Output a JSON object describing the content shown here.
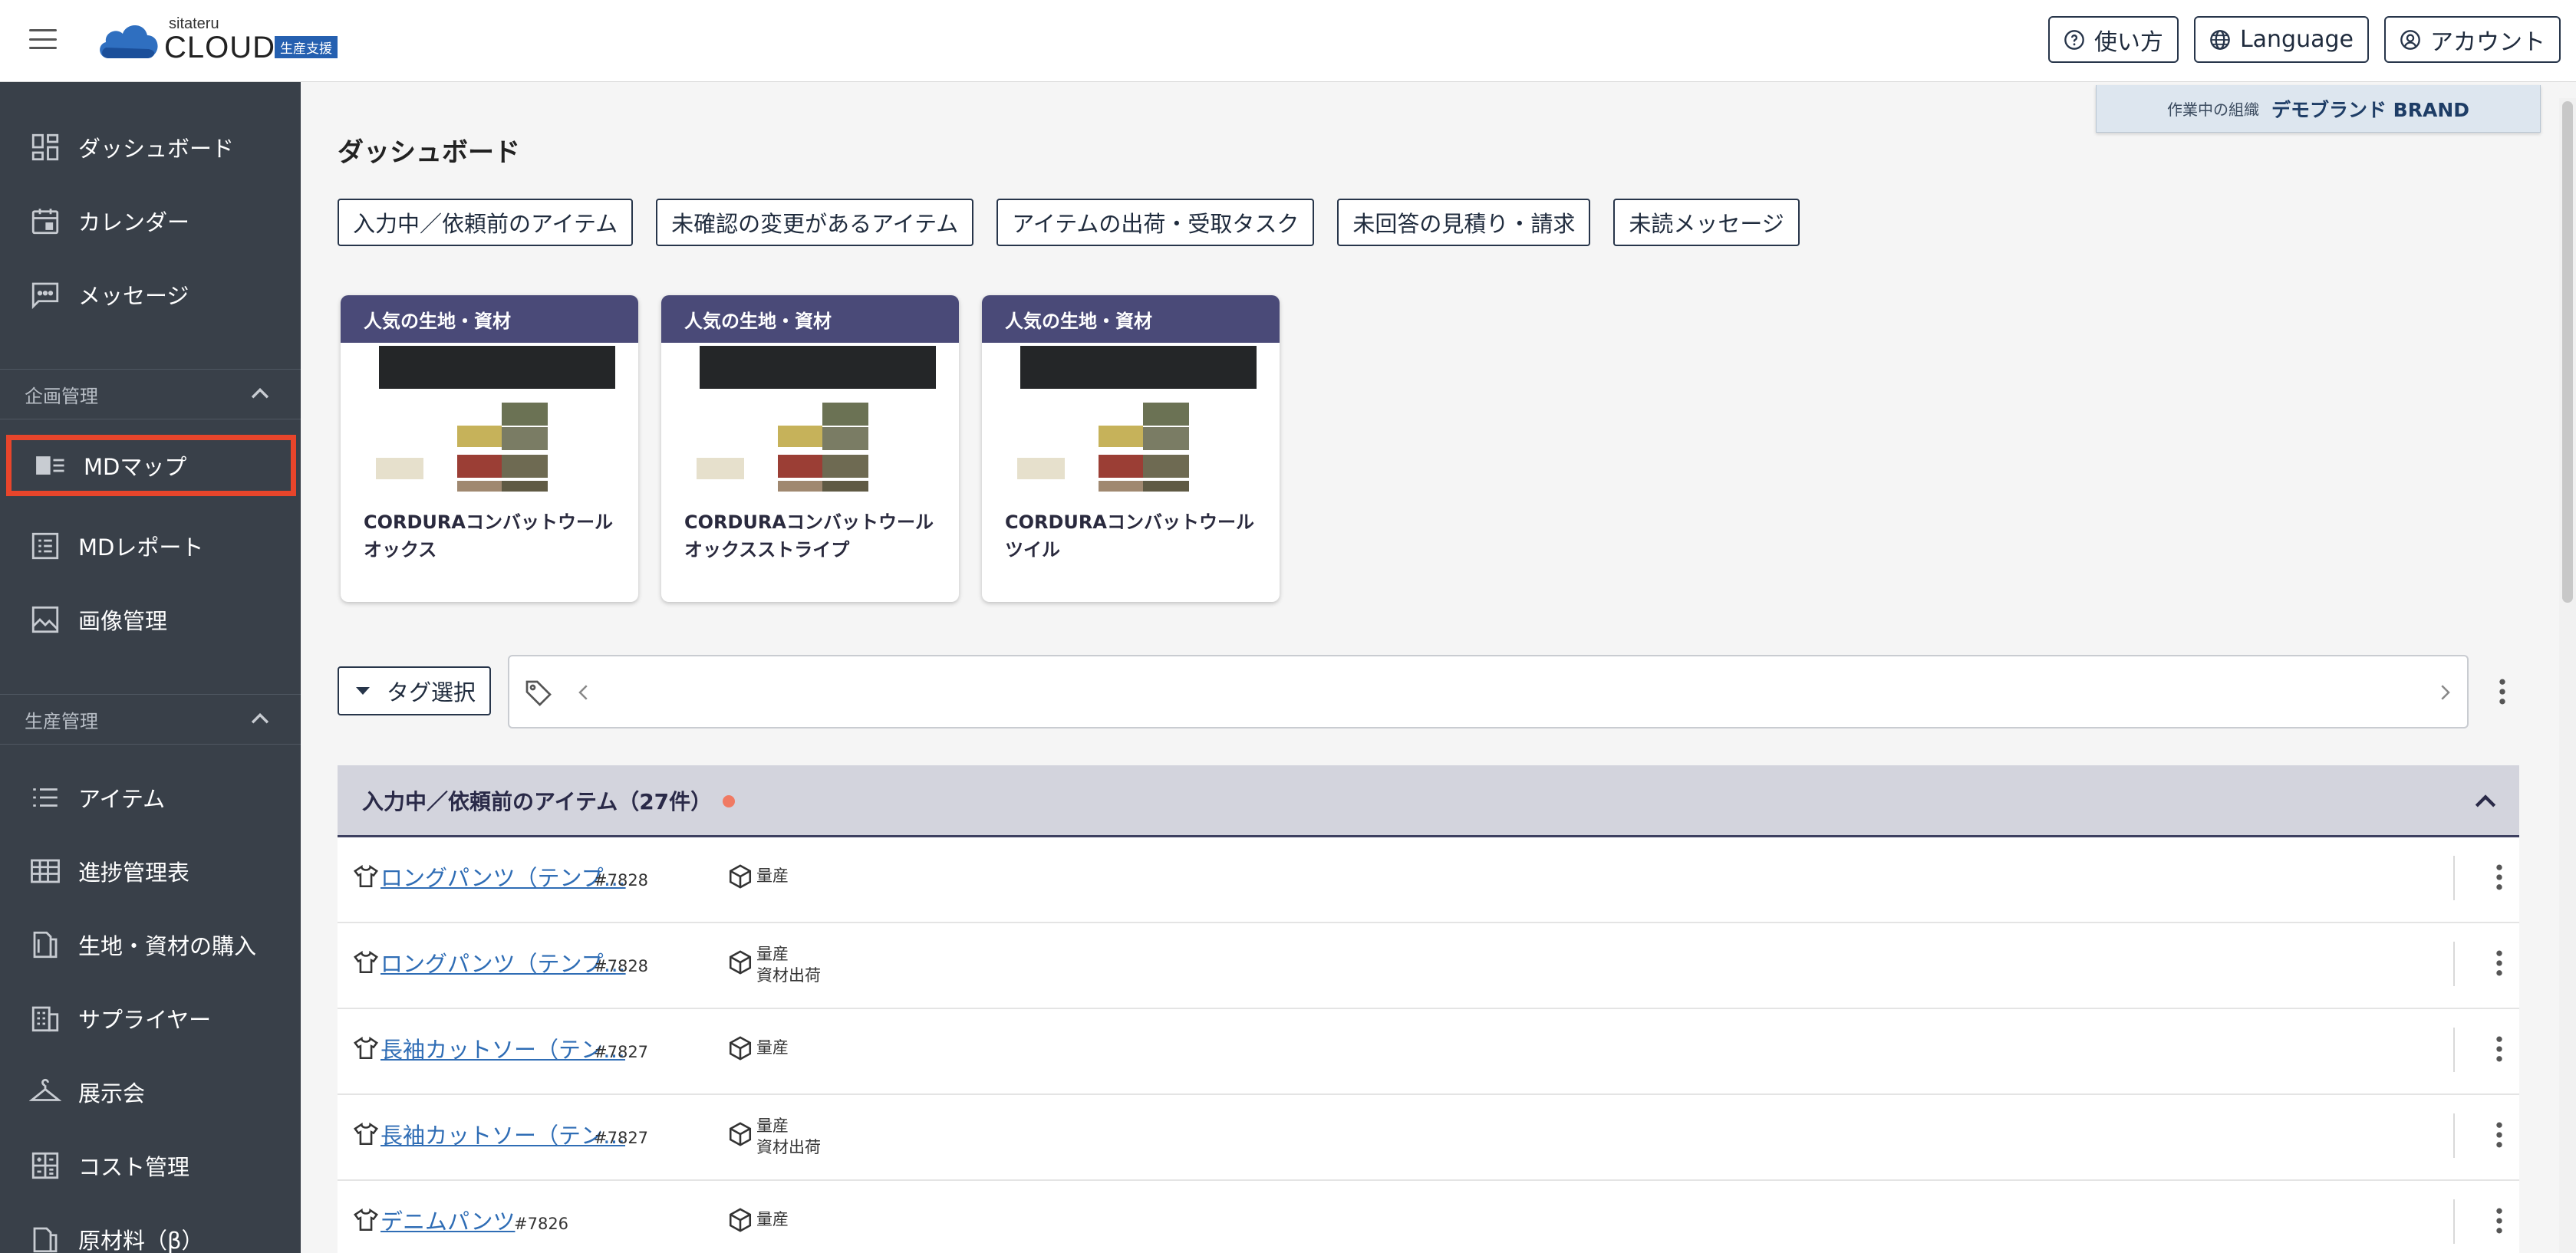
{
  "header": {
    "logo_small": "sitateru",
    "logo_main": "CLOUD",
    "logo_badge": "生産支援",
    "help_label": "使い方",
    "language_label": "Language",
    "account_label": "アカウント"
  },
  "org": {
    "label": "作業中の組織",
    "name": "デモブランド BRAND"
  },
  "sidebar": {
    "top_items": [
      {
        "label": "ダッシュボード",
        "icon": "dashboard-icon"
      },
      {
        "label": "カレンダー",
        "icon": "calendar-icon"
      },
      {
        "label": "メッセージ",
        "icon": "message-icon"
      }
    ],
    "section_planning": "企画管理",
    "planning_items": [
      {
        "label": "MDマップ",
        "icon": "md-map-icon"
      },
      {
        "label": "MDレポート",
        "icon": "report-icon"
      },
      {
        "label": "画像管理",
        "icon": "image-icon"
      }
    ],
    "section_production": "生産管理",
    "production_items": [
      {
        "label": "アイテム",
        "icon": "list-icon"
      },
      {
        "label": "進捗管理表",
        "icon": "grid-table-icon"
      },
      {
        "label": "生地・資材の購入",
        "icon": "fabric-icon"
      },
      {
        "label": "サプライヤー",
        "icon": "building-icon"
      },
      {
        "label": "展示会",
        "icon": "hanger-icon"
      },
      {
        "label": "コスト管理",
        "icon": "calculator-icon"
      },
      {
        "label": "原材料（β）",
        "icon": "material-icon"
      }
    ]
  },
  "main": {
    "title": "ダッシュボード",
    "filters": [
      "入力中／依頼前のアイテム",
      "未確認の変更があるアイテム",
      "アイテムの出荷・受取タスク",
      "未回答の見積り・請求",
      "未読メッセージ"
    ],
    "cards": [
      {
        "header": "人気の生地・資材",
        "title": "CORDURAコンバットウールオックス"
      },
      {
        "header": "人気の生地・資材",
        "title": "CORDURAコンバットウールオックスストライプ"
      },
      {
        "header": "人気の生地・資材",
        "title": "CORDURAコンバットウールツイル"
      }
    ],
    "tag_select_label": "タグ選択",
    "panel_title": "入力中／依頼前のアイテム（27件）",
    "rows": [
      {
        "name": "ロングパンツ（テンプ…",
        "num": "#7828",
        "type1": "量産",
        "type2": ""
      },
      {
        "name": "ロングパンツ（テンプ…",
        "num": "#7828",
        "type1": "量産",
        "type2": "資材出荷"
      },
      {
        "name": "長袖カットソー（テン…",
        "num": "#7827",
        "type1": "量産",
        "type2": ""
      },
      {
        "name": "長袖カットソー（テン…",
        "num": "#7827",
        "type1": "量産",
        "type2": "資材出荷"
      },
      {
        "name": "デニムパンツ",
        "num": "#7826",
        "type1": "量産",
        "type2": ""
      }
    ]
  }
}
